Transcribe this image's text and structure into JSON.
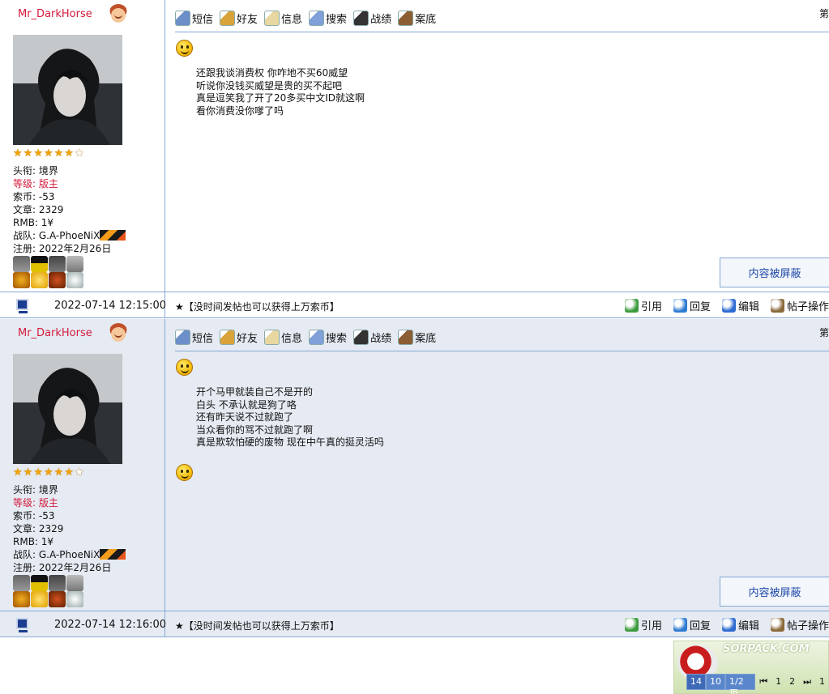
{
  "posts": [
    {
      "username": "Mr_DarkHorse",
      "stars": {
        "filled": 6,
        "total": 7
      },
      "info": {
        "title_label": "头衔:",
        "title_value": "境界",
        "level_label": "等级:",
        "level_value": "版主",
        "coins_label": "索币:",
        "coins_value": "-53",
        "articles_label": "文章:",
        "articles_value": "2329",
        "rmb_label": "RMB:",
        "rmb_value": "1¥",
        "team_label": "战队:",
        "team_value": "G.A-PhoeNiX",
        "register_label": "注册:",
        "register_value": "2022年2月26日"
      },
      "toolbar": [
        "短信",
        "好友",
        "信息",
        "搜索",
        "战绩",
        "案底"
      ],
      "floor": "第",
      "message": [
        "还跟我谈消费权 你咋地不买60威望",
        "听说你没钱买威望是贵的买不起吧",
        "真是逗笑我了开了20多买中文ID就这啊",
        "看你消费没你嗲了吗"
      ],
      "blocked": "内容被屏蔽",
      "datetime": "2022-07-14 12:15:00",
      "signature": "★【没时间发帖也可以获得上万索币】",
      "actions": [
        "引用",
        "回复",
        "编辑",
        "帖子操作"
      ]
    },
    {
      "username": "Mr_DarkHorse",
      "stars": {
        "filled": 6,
        "total": 7
      },
      "info": {
        "title_label": "头衔:",
        "title_value": "境界",
        "level_label": "等级:",
        "level_value": "版主",
        "coins_label": "索币:",
        "coins_value": "-53",
        "articles_label": "文章:",
        "articles_value": "2329",
        "rmb_label": "RMB:",
        "rmb_value": "1¥",
        "team_label": "战队:",
        "team_value": "G.A-PhoeNiX",
        "register_label": "注册:",
        "register_value": "2022年2月26日"
      },
      "toolbar": [
        "短信",
        "好友",
        "信息",
        "搜索",
        "战绩",
        "案底"
      ],
      "floor": "第",
      "message": [
        "开个马甲就装自己不是开的",
        "白头 不承认就是狗了咯",
        "还有昨天说不过就跑了",
        "当众看你的骂不过就跑了啊",
        "真是欺软怕硬的废物 现在中午真的挺灵活吗"
      ],
      "blocked": "内容被屏蔽",
      "datetime": "2022-07-14 12:16:00",
      "signature": "★【没时间发帖也可以获得上万索币】",
      "actions": [
        "引用",
        "回复",
        "编辑",
        "帖子操作"
      ]
    }
  ],
  "watermark": "SORPACK.COM",
  "pager": {
    "total": "14",
    "per_page": "10",
    "pages": "1/2页",
    "first": "⏮",
    "page1": "1",
    "page2": "2",
    "last": "⏭",
    "trailing": "1"
  },
  "colors": {
    "accent_blue": "#86a8d6",
    "username_red": "#d21b3c",
    "blocked_text": "#1f4aa8",
    "alt_row": "#e6ebf3"
  }
}
